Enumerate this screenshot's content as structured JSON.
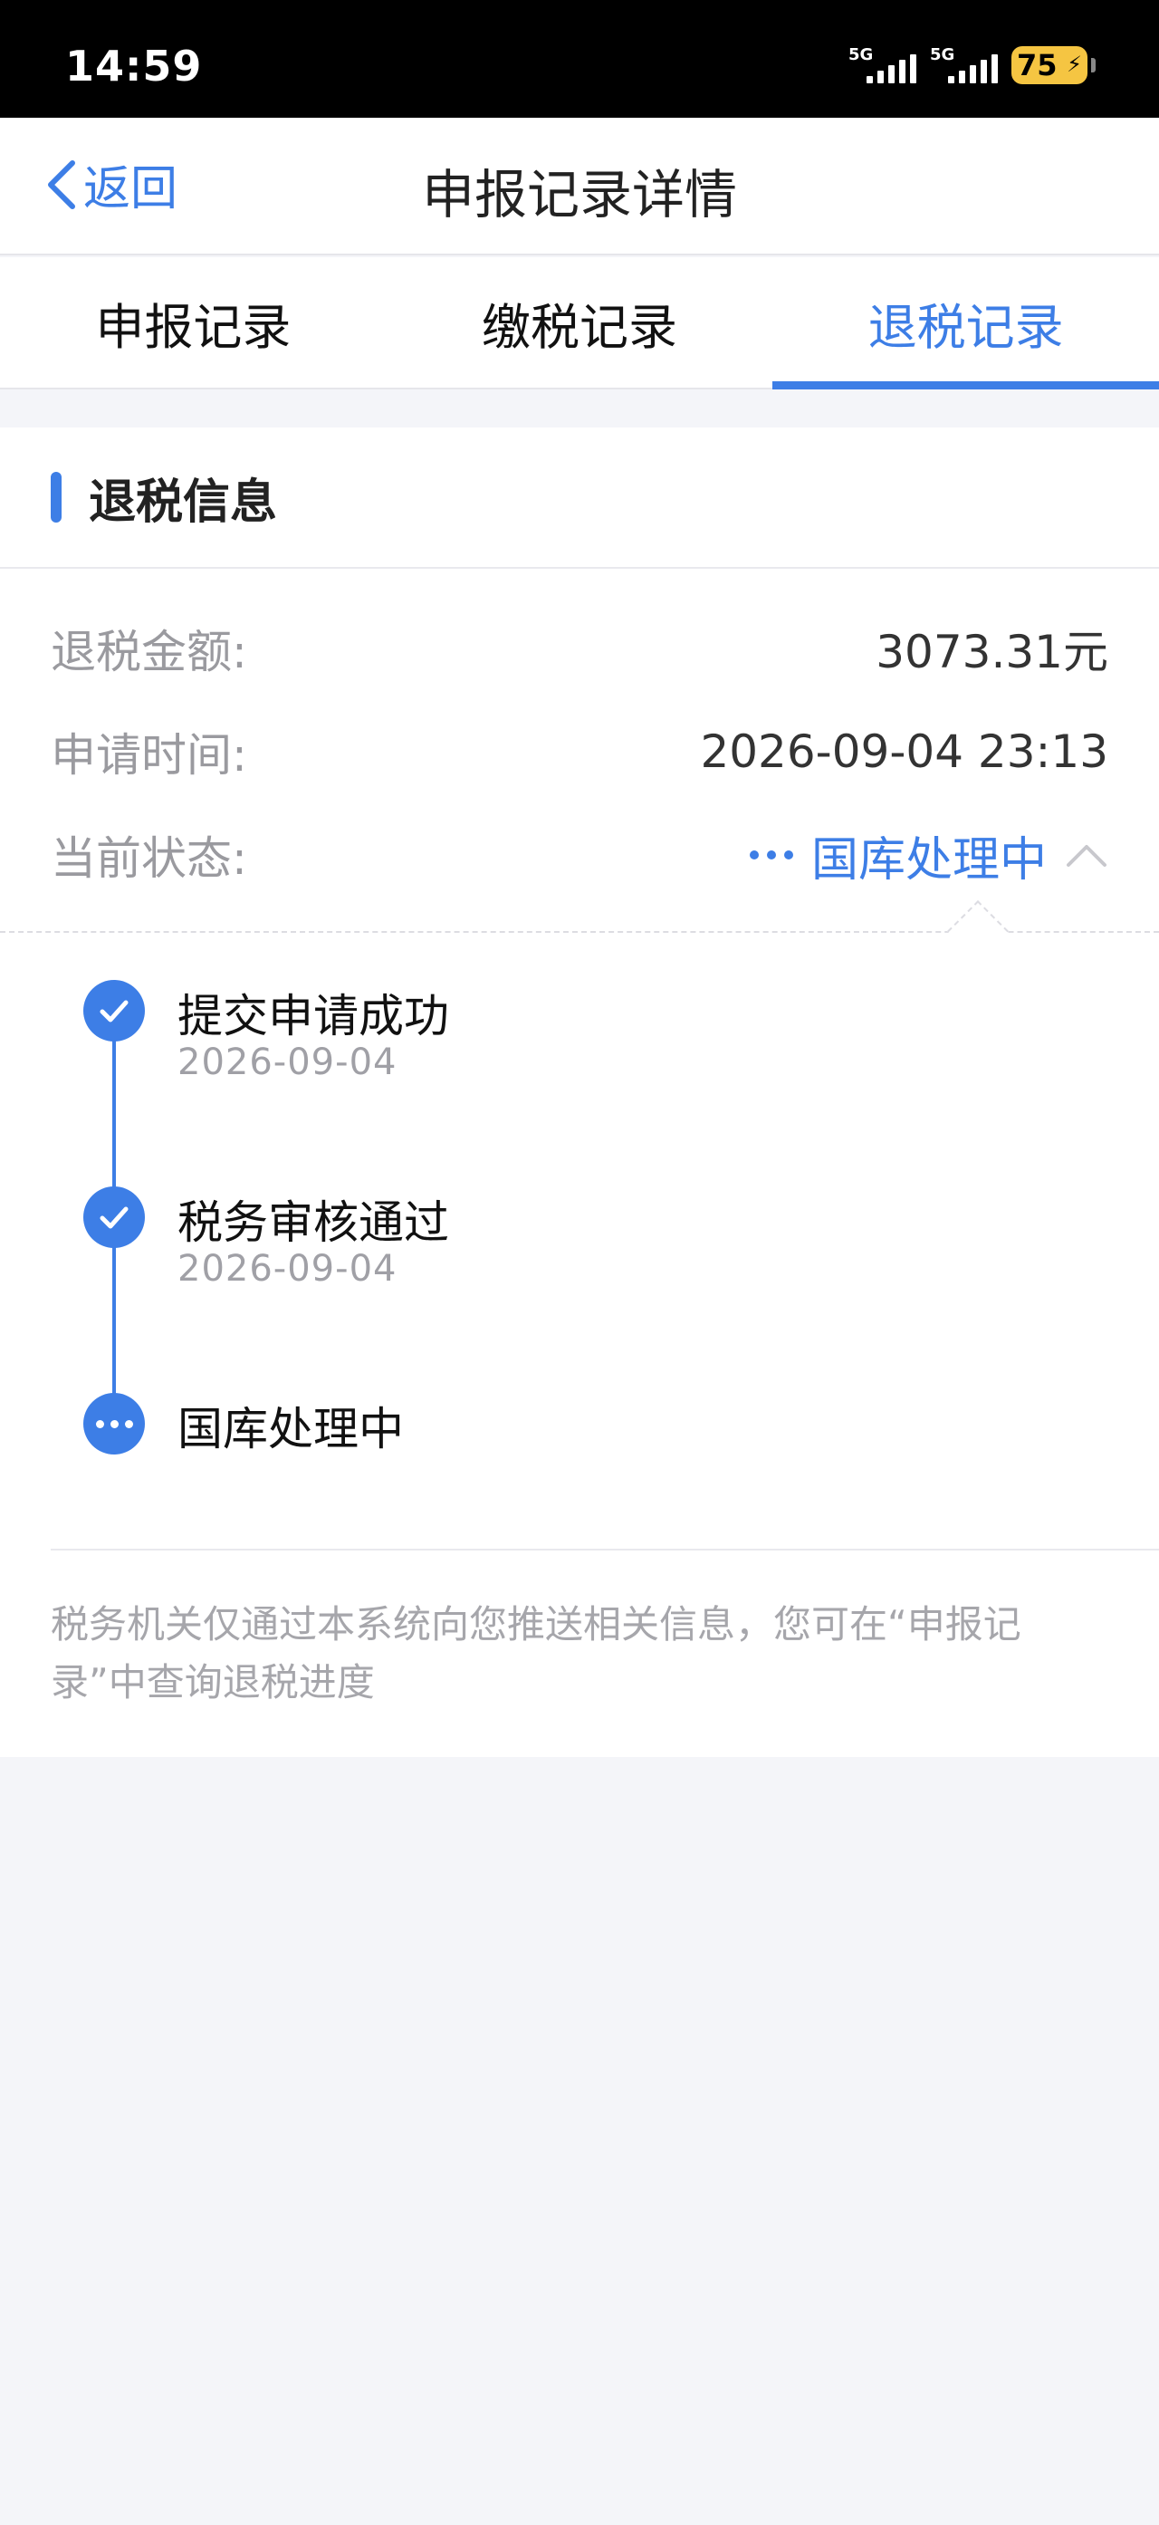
{
  "status_bar": {
    "time": "14:59",
    "signal1_label": "5G",
    "signal2_label": "5G",
    "battery": "75"
  },
  "nav": {
    "back_label": "返回",
    "title": "申报记录详情"
  },
  "tabs": [
    {
      "label": "申报记录"
    },
    {
      "label": "缴税记录"
    },
    {
      "label": "退税记录"
    }
  ],
  "section": {
    "title": "退税信息"
  },
  "info": {
    "amount_label": "退税金额:",
    "amount_value": "3073.31元",
    "time_label": "申请时间:",
    "time_value": "2026-09-04 23:13",
    "status_label": "当前状态:",
    "status_value": "国库处理中"
  },
  "timeline": [
    {
      "title": "提交申请成功",
      "date": "2026-09-04"
    },
    {
      "title": "税务审核通过",
      "date": "2026-09-04"
    },
    {
      "title": "国库处理中",
      "date": ""
    }
  ],
  "footer_note": "税务机关仅通过本系统向您推送相关信息，您可在“申报记录”中查询退税进度",
  "colors": {
    "accent": "#3d7ee6",
    "background": "#f4f5f9"
  }
}
